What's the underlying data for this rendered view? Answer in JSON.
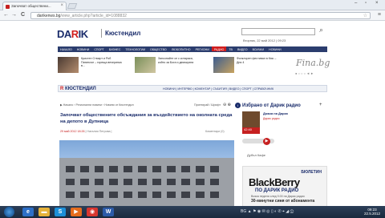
{
  "browser": {
    "tab_title": "Започват обществени...",
    "tab_close": "×",
    "url_host": "darikenws.bg",
    "url_rest": "/view_article.php?article_id=1088832",
    "nav": {
      "back": "←",
      "forward": "→",
      "reload": "C"
    }
  },
  "site": {
    "logo_main": "DA",
    "logo_r": "R",
    "logo_end": "IK",
    "city": "Кюстендил",
    "date_text": "Вторник, 22 май 2012 | 09:23",
    "main_nav": [
      "НАЧАЛО",
      "НОВИНИ",
      "СПОРТ",
      "БИЗНЕС",
      "ТЕХНОЛОГИИ",
      "ОБЩЕСТВО",
      "ЛЮБОПИТНО",
      "РЕГИОНИ",
      "РАДИО",
      "ТВ",
      "ВИДЕО",
      "ВСИЧКИ",
      "НОВИНИ"
    ],
    "promos": [
      {
        "text": "Кристен Стюарт и Роб Патинсън – гореща вечеринка в..."
      },
      {
        "text": "Запознайте се с котарака, който за Бога и демократа"
      },
      {
        "text": "Фолклорен фестивал в Кюс – Дня 4"
      }
    ],
    "fina_logo": "Fina.bg",
    "fina_dots": "● ○ ○ ○ ◄ ►",
    "subnav_logo_main": "КЮСТЕНДИЛ",
    "subnav_items": "НОВИНИ | ИНТЕРВЮ | КОМЕНТАР | СЪБИТИЯ | ВИДЕО | СПОРТ | СПРАВОЧНИК"
  },
  "article": {
    "breadcrumbs": "▶ Начало › Регионални новини › Новини от Кюстендил",
    "print_label": "Принтирай / Шрифт",
    "print_icons": "⊖ ⊕",
    "headline": "Започват обществените обсъждания за въздействието на околната среда на депото в Дупница",
    "date_meta": "29 май 2012 18:26",
    "author_meta": "| Наталия Петрова | ",
    "comments": "Коментари (0)"
  },
  "sidebar": {
    "icon_text": "i",
    "title": "Избрано от Дарик радио",
    "plus": "+",
    "name": "Джаза на Дарик",
    "subtitle": "Дарик радио",
    "badge": "42:40",
    "play_symbol": "▶",
    "next_item": "Дубъл Кафе"
  },
  "ad": {
    "tag": "БЮЛЕТИН",
    "brand": "BlackBerry",
    "station": "ПО ДАРИК РАДИО",
    "line": "Всяка неделя след 9.00 на Дарик радио",
    "big": "30-минутни синя от абонамента"
  },
  "taskbar": {
    "apps": [
      {
        "name": "ie",
        "glyph": "e",
        "color": "#2d6fc7"
      },
      {
        "name": "explorer",
        "glyph": "▬",
        "color": "#e5b23a"
      },
      {
        "name": "skype",
        "glyph": "S",
        "color": "#1c8fd8"
      },
      {
        "name": "media",
        "glyph": "▶",
        "color": "#e56c1d"
      },
      {
        "name": "chrome",
        "glyph": "◉",
        "color": "#d8362f"
      },
      {
        "name": "word",
        "glyph": "W",
        "color": "#2b5aa8"
      }
    ],
    "tray": "BG ▲ ⚑ ◉ ✉ ◎ ▯ ◐ ✆ ⌖ ◢ ⓘ",
    "time": "09:23",
    "date": "22.5.2012"
  }
}
